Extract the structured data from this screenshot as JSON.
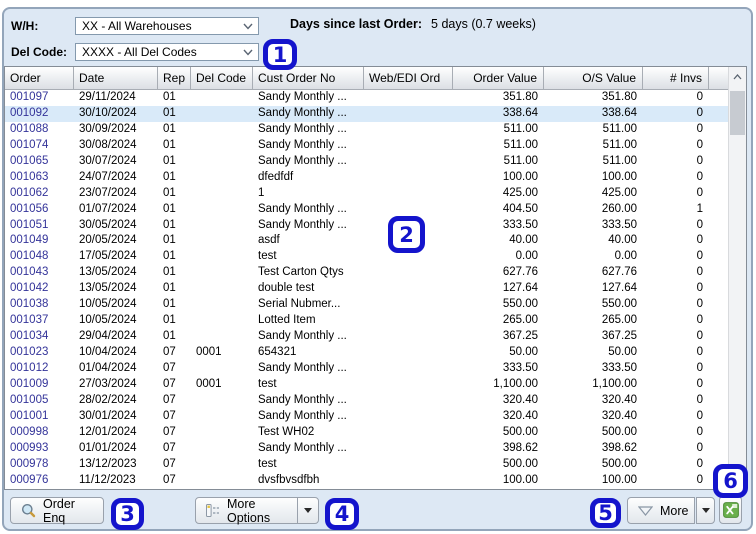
{
  "filters": {
    "wh_label": "W/H:",
    "wh_value": "XX - All Warehouses",
    "del_code_label": "Del Code:",
    "del_code_value": "XXXX - All Del Codes"
  },
  "summary": {
    "days_since_label": "Days since last Order:",
    "days_since_value": "5 days (0.7 weeks)"
  },
  "table": {
    "selected_row_index": 1,
    "columns": [
      {
        "key": "order",
        "label": "Order",
        "align": "left"
      },
      {
        "key": "date",
        "label": "Date",
        "align": "left"
      },
      {
        "key": "rep",
        "label": "Rep",
        "align": "left"
      },
      {
        "key": "del-code",
        "label": "Del Code",
        "align": "left"
      },
      {
        "key": "cust-order-no",
        "label": "Cust Order No",
        "align": "left"
      },
      {
        "key": "web-edi-ord",
        "label": "Web/EDI Ord",
        "align": "left"
      },
      {
        "key": "order-value",
        "label": "Order Value",
        "align": "right"
      },
      {
        "key": "os-value",
        "label": "O/S Value",
        "align": "right"
      },
      {
        "key": "num-invs",
        "label": "# Invs",
        "align": "right"
      },
      {
        "key": "filler",
        "label": "",
        "align": "left"
      }
    ],
    "rows": [
      [
        "001097",
        "29/11/2024",
        "01",
        "",
        "Sandy Monthly ...",
        "",
        "351.80",
        "351.80",
        "0"
      ],
      [
        "001092",
        "30/10/2024",
        "01",
        "",
        "Sandy Monthly ...",
        "",
        "338.64",
        "338.64",
        "0"
      ],
      [
        "001088",
        "30/09/2024",
        "01",
        "",
        "Sandy Monthly ...",
        "",
        "511.00",
        "511.00",
        "0"
      ],
      [
        "001074",
        "30/08/2024",
        "01",
        "",
        "Sandy Monthly ...",
        "",
        "511.00",
        "511.00",
        "0"
      ],
      [
        "001065",
        "30/07/2024",
        "01",
        "",
        "Sandy Monthly ...",
        "",
        "511.00",
        "511.00",
        "0"
      ],
      [
        "001063",
        "24/07/2024",
        "01",
        "",
        "dfedfdf",
        "",
        "100.00",
        "100.00",
        "0"
      ],
      [
        "001062",
        "23/07/2024",
        "01",
        "",
        "1",
        "",
        "425.00",
        "425.00",
        "0"
      ],
      [
        "001056",
        "01/07/2024",
        "01",
        "",
        "Sandy Monthly ...",
        "",
        "404.50",
        "260.00",
        "1"
      ],
      [
        "001051",
        "30/05/2024",
        "01",
        "",
        "Sandy Monthly ...",
        "",
        "333.50",
        "333.50",
        "0"
      ],
      [
        "001049",
        "20/05/2024",
        "01",
        "",
        "asdf",
        "",
        "40.00",
        "40.00",
        "0"
      ],
      [
        "001048",
        "17/05/2024",
        "01",
        "",
        "test",
        "",
        "0.00",
        "0.00",
        "0"
      ],
      [
        "001043",
        "13/05/2024",
        "01",
        "",
        "Test Carton Qtys",
        "",
        "627.76",
        "627.76",
        "0"
      ],
      [
        "001042",
        "13/05/2024",
        "01",
        "",
        "double test",
        "",
        "127.64",
        "127.64",
        "0"
      ],
      [
        "001038",
        "10/05/2024",
        "01",
        "",
        "Serial Nubmer...",
        "",
        "550.00",
        "550.00",
        "0"
      ],
      [
        "001037",
        "10/05/2024",
        "01",
        "",
        "Lotted Item",
        "",
        "265.00",
        "265.00",
        "0"
      ],
      [
        "001034",
        "29/04/2024",
        "01",
        "",
        "Sandy Monthly ...",
        "",
        "367.25",
        "367.25",
        "0"
      ],
      [
        "001023",
        "10/04/2024",
        "07",
        "0001",
        "654321",
        "",
        "50.00",
        "50.00",
        "0"
      ],
      [
        "001012",
        "01/04/2024",
        "07",
        "",
        "Sandy Monthly ...",
        "",
        "333.50",
        "333.50",
        "0"
      ],
      [
        "001009",
        "27/03/2024",
        "07",
        "0001",
        "test",
        "",
        "1,100.00",
        "1,100.00",
        "0"
      ],
      [
        "001005",
        "28/02/2024",
        "07",
        "",
        "Sandy Monthly ...",
        "",
        "320.40",
        "320.40",
        "0"
      ],
      [
        "001001",
        "30/01/2024",
        "07",
        "",
        "Sandy Monthly ...",
        "",
        "320.40",
        "320.40",
        "0"
      ],
      [
        "000998",
        "12/01/2024",
        "07",
        "",
        "Test WH02",
        "",
        "500.00",
        "500.00",
        "0"
      ],
      [
        "000993",
        "01/01/2024",
        "07",
        "",
        "Sandy Monthly ...",
        "",
        "398.62",
        "398.62",
        "0"
      ],
      [
        "000978",
        "13/12/2023",
        "07",
        "",
        "test",
        "",
        "500.00",
        "500.00",
        "0"
      ],
      [
        "000976",
        "11/12/2023",
        "07",
        "",
        "dvsfbvsdfbh",
        "",
        "100.00",
        "100.00",
        "0"
      ]
    ]
  },
  "toolbar": {
    "order_enq_label": "Order Enq",
    "more_options_label": "More Options",
    "more_label": "More",
    "excel_icon": "excel-export-icon",
    "search_icon": "magnifier-icon"
  },
  "annotations": [
    "1",
    "2",
    "3",
    "4",
    "5",
    "6"
  ],
  "colors": {
    "annotation": "#1414cc",
    "selected_row": "#d9eaf9",
    "order_link": "#333399",
    "excel_green": "#6ab04c",
    "panel_bg": "#dde8f4"
  }
}
